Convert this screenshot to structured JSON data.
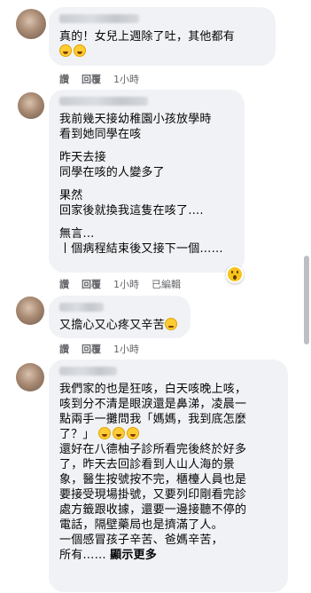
{
  "comments": [
    {
      "lines": [
        "真的！女兒上週除了吐，其他都有"
      ],
      "emoji_line_count": 2,
      "actions": {
        "like": "讚",
        "reply": "回覆",
        "time": "1小時"
      }
    },
    {
      "lines": [
        "我前幾天接幼稚園小孩放學時",
        "看到她同學在咳",
        "",
        "昨天去接",
        "同學在咳的人變多了",
        "",
        "果然",
        "回家後就換我這隻在咳了….",
        "",
        "無言…",
        "丨個病程結束後又接下一個……"
      ],
      "reaction": "wow-icon",
      "actions": {
        "like": "讚",
        "reply": "回覆",
        "time": "1小時",
        "edited": "已編輯"
      }
    },
    {
      "lines": [
        "又擔心又心疼又辛苦"
      ],
      "actions": {
        "like": "讚",
        "reply": "回覆",
        "time": "1小時"
      }
    },
    {
      "lines": [
        "我們家的也是狂咳，白天咳晚上咳，",
        "咳到分不清是眼淚還是鼻涕，凌晨一",
        "點兩手一攤問我「媽媽，我到底怎麼",
        "了？」",
        "還好在八德柚子診所看完後終於好多",
        "了，昨天去回診看到人山人海的景",
        "象，醫生按號按不完，櫃檯人員也是",
        "要接受現場掛號，又要列印剛看完診",
        "處方籤跟收據，還要一邊接聽不停的",
        "電話，隔壁藥局也是擠滿了人。",
        "一個感冒孩子辛苦、爸媽辛苦，",
        "所有……"
      ],
      "see_more": "顯示更多"
    }
  ],
  "colors": {
    "bubble": "#f0f2f5",
    "meta": "#65676b",
    "text": "#050505"
  }
}
